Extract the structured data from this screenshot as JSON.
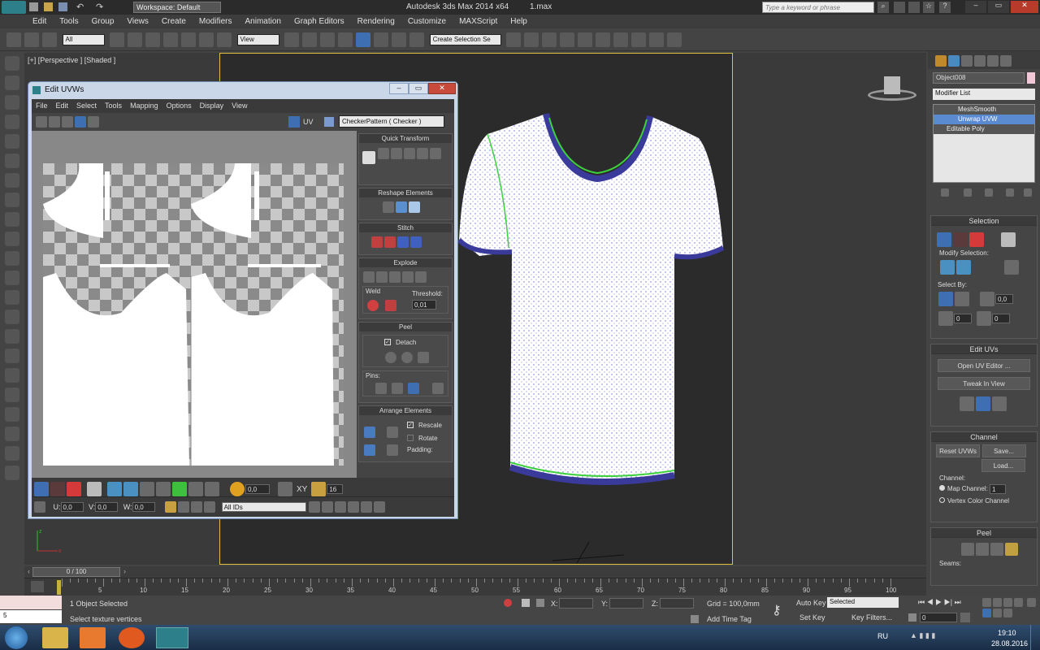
{
  "app": {
    "workspace": "Workspace: Default",
    "title": "Autodesk 3ds Max  2014 x64",
    "file": "1.max",
    "search_placeholder": "Type a keyword or phrase"
  },
  "menu": [
    "Edit",
    "Tools",
    "Group",
    "Views",
    "Create",
    "Modifiers",
    "Animation",
    "Graph Editors",
    "Rendering",
    "Customize",
    "MAXScript",
    "Help"
  ],
  "toolbar": {
    "filter": "All",
    "ref_coord": "View",
    "selection_set": "Create Selection Se"
  },
  "viewport": {
    "label": "[+] [Perspective ] [Shaded ]"
  },
  "command_panel": {
    "object_name": "Object008",
    "object_color": "#f0c8d8",
    "modifier_list": "Modifier List",
    "stack": [
      "MeshSmooth",
      "Unwrap UVW",
      "Editable Poly"
    ],
    "selection_title": "Selection",
    "modify_selection": "Modify Selection:",
    "select_by": "Select By:",
    "select_by_value": "0,0",
    "spin_a": "0",
    "spin_b": "0",
    "edit_uvs_title": "Edit UVs",
    "open_uv_editor": "Open UV Editor ...",
    "tweak_in_view": "Tweak In View",
    "channel_title": "Channel",
    "reset_uvws": "Reset UVWs",
    "save": "Save...",
    "load": "Load...",
    "channel_label": "Channel:",
    "map_channel": "Map Channel:",
    "map_channel_value": "1",
    "vertex_color_channel": "Vertex Color Channel",
    "peel_title": "Peel",
    "seams": "Seams:"
  },
  "uvw": {
    "title": "Edit UVWs",
    "menu": [
      "File",
      "Edit",
      "Select",
      "Tools",
      "Mapping",
      "Options",
      "Display",
      "View"
    ],
    "uv_label": "UV",
    "pattern": "CheckerPattern  ( Checker )",
    "quick_transform": "Quick Transform",
    "reshape": "Reshape Elements",
    "stitch": "Stitch",
    "explode": "Explode",
    "weld": "Weld",
    "threshold": "Threshold:",
    "threshold_value": "0,01",
    "peel": "Peel",
    "detach": "Detach",
    "pins": "Pins:",
    "arrange": "Arrange Elements",
    "rescale": "Rescale",
    "rotate": "Rotate",
    "padding": "Padding:",
    "soft_value": "0,0",
    "xy": "XY",
    "grid_value": "16",
    "u_label": "U:",
    "u_value": "0,0",
    "v_label": "V:",
    "v_value": "0,0",
    "w_label": "W:",
    "w_value": "0,0",
    "ids": "All IDs"
  },
  "timeline": {
    "frame": "0 / 100",
    "ticks": [
      "5",
      "10",
      "15",
      "20",
      "25",
      "30",
      "35",
      "40",
      "45",
      "50",
      "55",
      "60",
      "65",
      "70",
      "75",
      "80",
      "85",
      "90",
      "95",
      "100"
    ]
  },
  "status": {
    "selected": "1 Object Selected",
    "prompt": "Select texture vertices",
    "maxscript_value": "5",
    "x_label": "X:",
    "y_label": "Y:",
    "z_label": "Z:",
    "grid": "Grid = 100,0mm",
    "add_time_tag": "Add Time Tag",
    "auto_key": "Auto Key",
    "auto_key_value": "Selected",
    "set_key": "Set Key",
    "key_filters": "Key Filters...",
    "frame_value": "0"
  },
  "taskbar": {
    "lang": "RU",
    "time": "19:10",
    "date": "28.08.2016"
  }
}
